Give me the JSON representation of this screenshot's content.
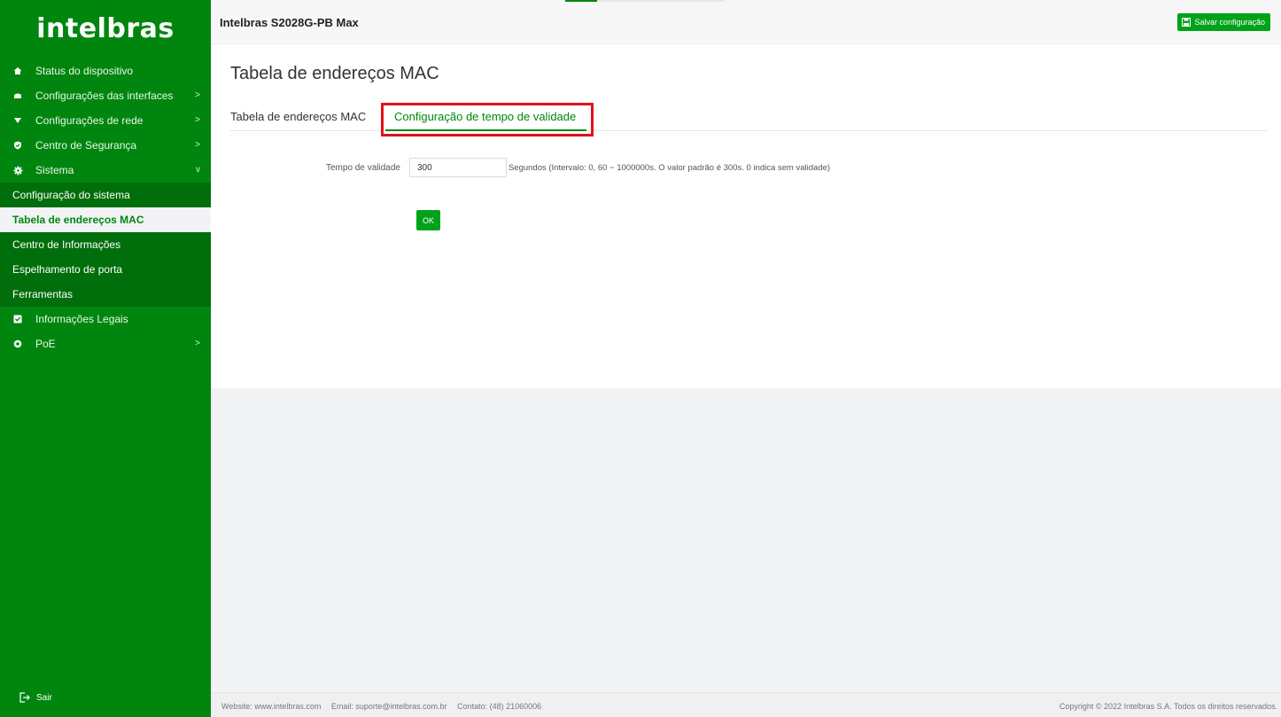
{
  "brand": {
    "logo": "intelbras"
  },
  "header": {
    "device_name": "Intelbras S2028G-PB Max",
    "save_label": "Salvar configuração"
  },
  "sidebar": {
    "items": [
      {
        "label": "Status do dispositivo",
        "icon": "home-icon",
        "chevron": ""
      },
      {
        "label": "Configurações das interfaces",
        "icon": "interface-icon",
        "chevron": ">"
      },
      {
        "label": "Configurações de rede",
        "icon": "network-icon",
        "chevron": ">"
      },
      {
        "label": "Centro de Segurança",
        "icon": "shield-icon",
        "chevron": ">"
      },
      {
        "label": "Sistema",
        "icon": "gear-icon",
        "chevron": "v"
      }
    ],
    "sistema_children": [
      {
        "label": "Configuração do sistema",
        "active": false
      },
      {
        "label": "Tabela de endereços MAC",
        "active": true
      },
      {
        "label": "Centro de Informações",
        "active": false
      },
      {
        "label": "Espelhamento de porta",
        "active": false
      },
      {
        "label": "Ferramentas",
        "active": false
      }
    ],
    "items_after": [
      {
        "label": "Informações Legais",
        "icon": "checkbox-icon",
        "chevron": ""
      },
      {
        "label": "PoE",
        "icon": "poe-icon",
        "chevron": ">"
      }
    ],
    "logout_label": "Sair"
  },
  "main": {
    "title": "Tabela de endereços MAC",
    "tabs": [
      {
        "label": "Tabela de endereços MAC",
        "active": false
      },
      {
        "label": "Configuração de tempo de validade",
        "active": true
      }
    ],
    "form": {
      "field_label": "Tempo de validade",
      "field_value": "300",
      "hint": "Segundos  (Intervalo: 0,  60 ~ 1000000s. O valor padrão é 300s. 0 indica sem validade)",
      "ok_label": "OK"
    }
  },
  "footer": {
    "website": "Website: www.intelbras.com",
    "email": "Email: suporte@intelbras.com.br",
    "contact": "Contato: (48) 21060006",
    "copyright": "Copyright © 2022 Intelbras S.A. Todos os direitos reservados."
  },
  "colors": {
    "brand_green": "#00860e",
    "button_green": "#00a21a",
    "highlight_red": "#e3101c"
  }
}
